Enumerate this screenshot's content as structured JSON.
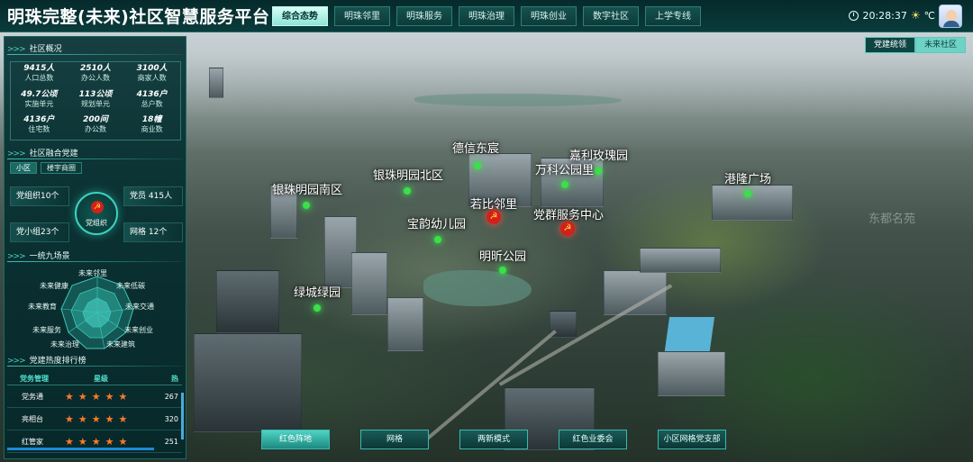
{
  "header": {
    "title": "明珠完整(未来)社区智慧服务平台",
    "tabs": [
      "综合态势",
      "明珠邻里",
      "明珠服务",
      "明珠治理",
      "明珠创业",
      "数字社区",
      "上学专线"
    ],
    "active_tab": "综合态势",
    "time": "20:28:37",
    "weather_unit": "℃"
  },
  "view_toggle": {
    "on": "党建统领",
    "off": "未来社区"
  },
  "overview": {
    "title": "社区概况",
    "stats": [
      {
        "value": "9415人",
        "label": "人口总数"
      },
      {
        "value": "2510人",
        "label": "办公人数"
      },
      {
        "value": "3100人",
        "label": "商家人数"
      },
      {
        "value": "49.7公顷",
        "label": "实施单元"
      },
      {
        "value": "113公顷",
        "label": "规划单元"
      },
      {
        "value": "4136户",
        "label": "总户数"
      },
      {
        "value": "4136户",
        "label": "住宅数"
      },
      {
        "value": "200间",
        "label": "办公数"
      },
      {
        "value": "18幢",
        "label": "商业数"
      }
    ]
  },
  "party": {
    "title": "社区融合党建",
    "tabs": [
      "小区",
      "楼宇商圈"
    ],
    "center": "党组织",
    "items": [
      {
        "label": "党组织",
        "value": "10个"
      },
      {
        "label": "党员",
        "value": "415人"
      },
      {
        "label": "党小组",
        "value": "23个"
      },
      {
        "label": "网格",
        "value": "12个"
      }
    ]
  },
  "scenes": {
    "title": "一统九场景",
    "labels": [
      "未来邻里",
      "未来低碳",
      "未来交通",
      "未来创业",
      "未来建筑",
      "未来治理",
      "未来服务",
      "未来教育",
      "未来健康"
    ]
  },
  "ranking": {
    "title": "党建热度排行榜",
    "columns": [
      "党务管理",
      "星级",
      "热"
    ],
    "rows": [
      {
        "name": "党务通",
        "stars": "★★★★★",
        "hot": "267"
      },
      {
        "name": "亮相台",
        "stars": "★★★★★",
        "hot": "320"
      },
      {
        "name": "红管家",
        "stars": "★★★★★",
        "hot": "251"
      }
    ]
  },
  "map": {
    "labels": [
      "德信东宸",
      "嘉利玫瑰园",
      "万科公园里",
      "银珠明园北区",
      "银珠明园南区",
      "若比邻里",
      "党群服务中心",
      "宝韵幼儿园",
      "明昕公园",
      "绿城绿园",
      "港隆广场",
      "东都名苑"
    ]
  },
  "bottom": {
    "buttons": [
      "红色阵地",
      "网格",
      "两新模式",
      "红色业委会",
      "小区网格党支部"
    ],
    "active": "红色阵地"
  },
  "colors": {
    "accent": "#48d3c2",
    "star": "#ff7a2a",
    "party_red": "#d3201a",
    "pin_green": "#3ae04a"
  }
}
